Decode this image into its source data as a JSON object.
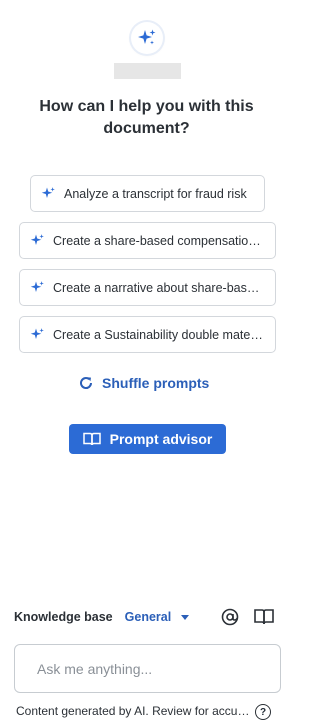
{
  "header": {
    "headline": "How can I help you with this document?"
  },
  "prompts": [
    {
      "label": "Analyze a transcript for fraud risk",
      "icon": "sparkle-icon"
    },
    {
      "label": "Create a share-based compensation prompt",
      "icon": "sparkle-icon"
    },
    {
      "label": "Create a narrative about share-based compensation",
      "icon": "sparkle-icon"
    },
    {
      "label": "Create a Sustainability double materiality prompt",
      "icon": "sparkle-icon"
    }
  ],
  "actions": {
    "shuffle_label": "Shuffle prompts",
    "advisor_label": "Prompt advisor"
  },
  "knowledge_base": {
    "label": "Knowledge base",
    "selected": "General"
  },
  "input": {
    "placeholder": "Ask me anything..."
  },
  "footer": {
    "disclaimer": "Content generated by AI. Review for accuracy.",
    "help_glyph": "?"
  },
  "colors": {
    "accent": "#2c6bd5",
    "link": "#2b5fb8",
    "text": "#2b3036"
  }
}
